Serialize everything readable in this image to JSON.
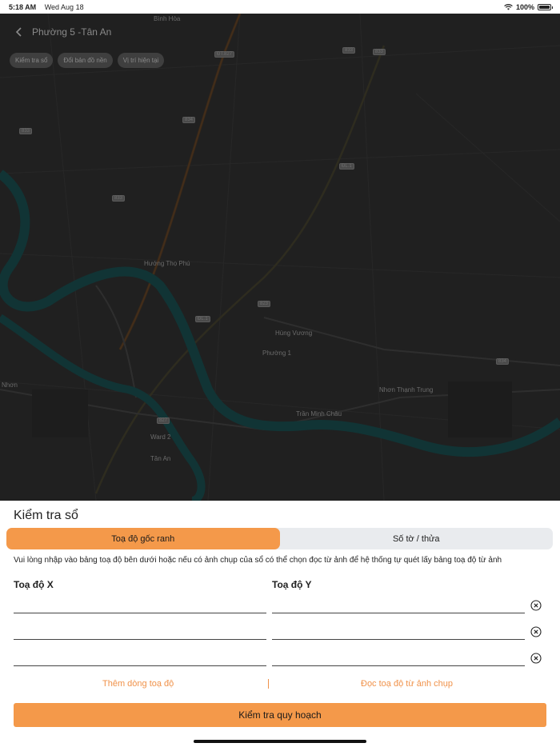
{
  "status_bar": {
    "time": "5:18 AM",
    "date": "Wed Aug 18",
    "battery": "100%"
  },
  "header": {
    "title": "Phường 5 -Tân An"
  },
  "map_chips": [
    "Kiểm tra sổ",
    "Đổi bản đồ nền",
    "Vị trí hiện tại"
  ],
  "map": {
    "places": [
      "Bình Hòa",
      "Hướng Thọ Phú",
      "Phường 1",
      "Nhơn Thạnh Trung",
      "Ward 2",
      "Tân An",
      "Nhơn"
    ],
    "roads": [
      "Quốc lộ 1",
      "Trần Minh Châu",
      "Hùng Vương",
      "Quốc Lộ 62"
    ],
    "badges": [
      "ĐT.827",
      "833",
      "833",
      "834",
      "833",
      "ĐL.1",
      "833",
      "823",
      "ĐL.1",
      "834",
      "827"
    ]
  },
  "sheet": {
    "title": "Kiểm tra sổ",
    "tabs": [
      "Toạ độ gốc ranh",
      "Số tờ / thửa"
    ],
    "active_tab": 0,
    "instruction": "Vui lòng nhập vào bảng toạ độ bên dưới hoặc nếu có ảnh chụp của sổ có thể chọn đọc từ ảnh để hệ thống tự quét lấy bảng toạ độ từ ảnh",
    "col_x": "Toạ độ X",
    "col_y": "Toạ độ Y",
    "rows": [
      {
        "x": "",
        "y": ""
      },
      {
        "x": "",
        "y": ""
      },
      {
        "x": "",
        "y": ""
      }
    ],
    "add_row": "Thêm dòng toạ độ",
    "read_image": "Đọc toạ độ từ ảnh chụp",
    "submit": "Kiểm tra quy hoạch"
  },
  "colors": {
    "accent": "#f4994a",
    "map_dark": "#3a3a3a",
    "river": "#1f6b6e"
  }
}
